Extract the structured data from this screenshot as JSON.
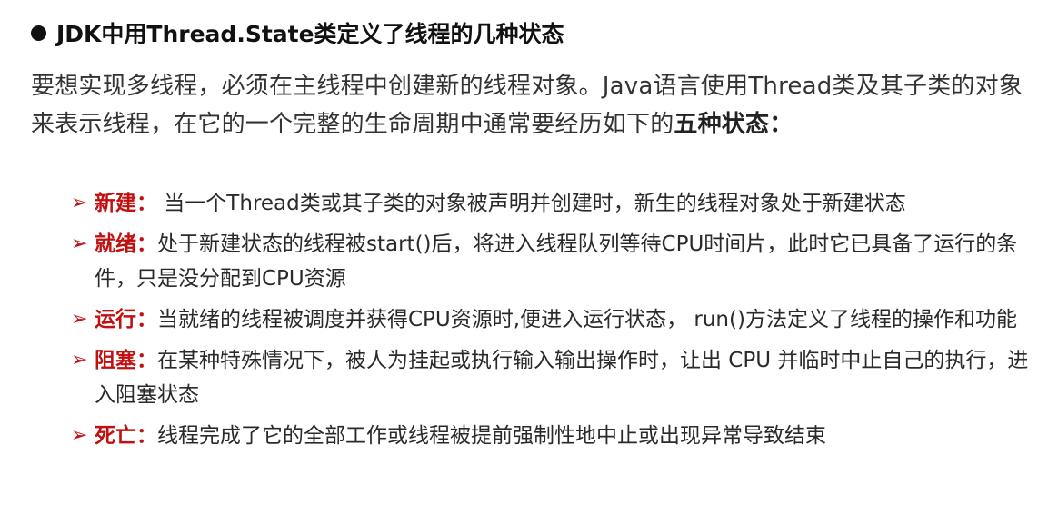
{
  "heading": {
    "bullet_icon": "filled-circle-bullet",
    "text": "JDK中用Thread.State类定义了线程的几种状态"
  },
  "intro": {
    "text": "要想实现多线程，必须在主线程中创建新的线程对象。Java语言使用Thread类及其子类的对象来表示线程，在它的一个完整的生命周期中通常要经历如下的",
    "emphasis": "五种状态："
  },
  "accent_color": "#c01010",
  "arrow_glyph": "➢",
  "states": [
    {
      "term": "新建：",
      "description": " 当一个Thread类或其子类的对象被声明并创建时，新生的线程对象处于新建状态"
    },
    {
      "term": "就绪：",
      "description": "处于新建状态的线程被start()后，将进入线程队列等待CPU时间片，此时它已具备了运行的条件，只是没分配到CPU资源"
    },
    {
      "term": "运行：",
      "description": "当就绪的线程被调度并获得CPU资源时,便进入运行状态， run()方法定义了线程的操作和功能"
    },
    {
      "term": "阻塞：",
      "description": "在某种特殊情况下，被人为挂起或执行输入输出操作时，让出 CPU 并临时中止自己的执行，进入阻塞状态"
    },
    {
      "term": "死亡：",
      "description": "线程完成了它的全部工作或线程被提前强制性地中止或出现异常导致结束"
    }
  ]
}
